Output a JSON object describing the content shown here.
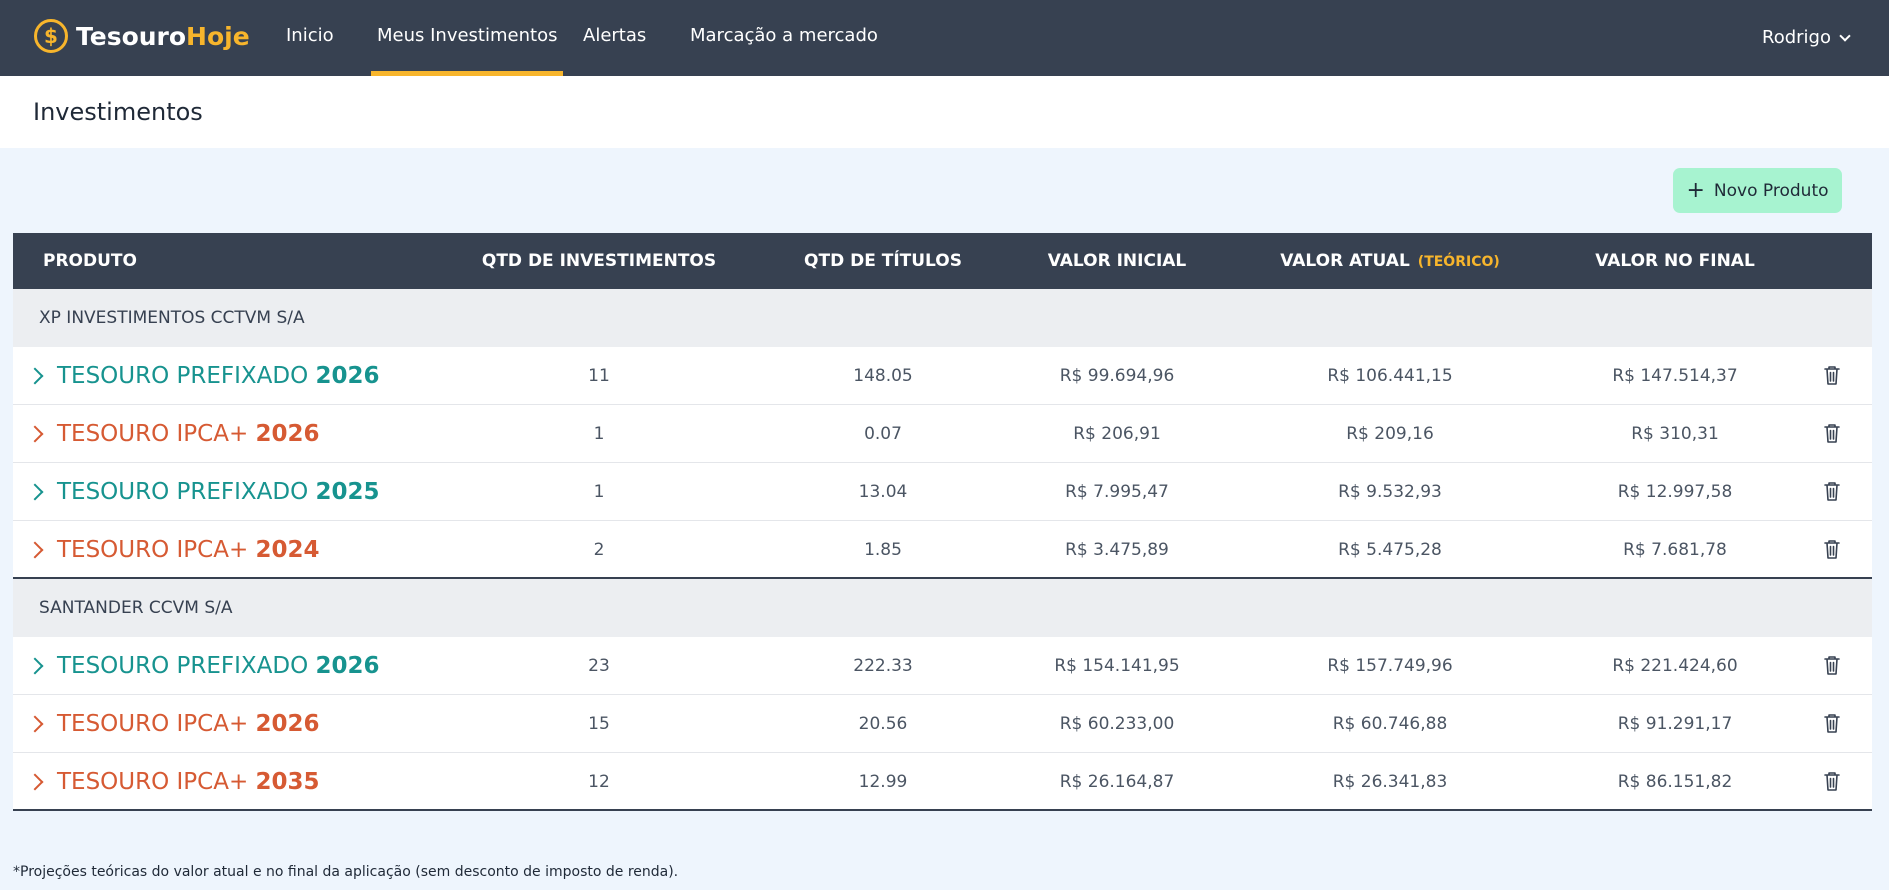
{
  "app": {
    "logo_part1": "Tesouro",
    "logo_part2": "Hoje",
    "brand_color": "#f7b52c",
    "header_color": "#374151"
  },
  "nav": {
    "items": [
      "Inicio",
      "Meus Investimentos",
      "Alertas",
      "Marcação a mercado"
    ],
    "active": "Meus Investimentos"
  },
  "user": {
    "name": "Rodrigo"
  },
  "page": {
    "title": "Investimentos",
    "new_button": "Novo Produto"
  },
  "table": {
    "headers": {
      "produto": "PRODUTO",
      "qtd_investimentos": "QTD DE INVESTIMENTOS",
      "qtd_titulos": "QTD DE TÍTULOS",
      "valor_inicial": "VALOR INICIAL",
      "valor_atual": "VALOR ATUAL",
      "valor_atual_note": "(TEÓRICO)",
      "valor_final": "VALOR NO FINAL"
    },
    "groups": [
      {
        "broker": "XP INVESTIMENTOS CCTVM S/A",
        "rows": [
          {
            "name": "TESOURO PREFIXADO",
            "year": "2026",
            "kind": "prefixado",
            "qtd": "11",
            "titulos": "148.05",
            "inicial": "R$ 99.694,96",
            "atual": "R$ 106.441,15",
            "final": "R$ 147.514,37"
          },
          {
            "name": "TESOURO IPCA+",
            "year": "2026",
            "kind": "ipca",
            "qtd": "1",
            "titulos": "0.07",
            "inicial": "R$ 206,91",
            "atual": "R$ 209,16",
            "final": "R$ 310,31"
          },
          {
            "name": "TESOURO PREFIXADO",
            "year": "2025",
            "kind": "prefixado",
            "qtd": "1",
            "titulos": "13.04",
            "inicial": "R$ 7.995,47",
            "atual": "R$ 9.532,93",
            "final": "R$ 12.997,58"
          },
          {
            "name": "TESOURO IPCA+",
            "year": "2024",
            "kind": "ipca",
            "qtd": "2",
            "titulos": "1.85",
            "inicial": "R$ 3.475,89",
            "atual": "R$ 5.475,28",
            "final": "R$ 7.681,78"
          }
        ]
      },
      {
        "broker": "SANTANDER CCVM S/A",
        "rows": [
          {
            "name": "TESOURO PREFIXADO",
            "year": "2026",
            "kind": "prefixado",
            "qtd": "23",
            "titulos": "222.33",
            "inicial": "R$ 154.141,95",
            "atual": "R$ 157.749,96",
            "final": "R$ 221.424,60"
          },
          {
            "name": "TESOURO IPCA+",
            "year": "2026",
            "kind": "ipca",
            "qtd": "15",
            "titulos": "20.56",
            "inicial": "R$ 60.233,00",
            "atual": "R$ 60.746,88",
            "final": "R$ 91.291,17"
          },
          {
            "name": "TESOURO IPCA+",
            "year": "2035",
            "kind": "ipca",
            "qtd": "12",
            "titulos": "12.99",
            "inicial": "R$ 26.164,87",
            "atual": "R$ 26.341,83",
            "final": "R$ 86.151,82"
          }
        ]
      }
    ]
  },
  "colors": {
    "prefixado": "#17938f",
    "ipca": "#d65a33",
    "new_button": "#a7f3d0"
  },
  "footnote": "*Projeções teóricas do valor atual e no final da aplicação (sem desconto de imposto de renda).",
  "icons": {
    "logo": "dollar-coin-icon",
    "row_expand": "chevron-right-icon",
    "row_delete": "trash-icon",
    "user_menu": "chevron-down-icon",
    "new_button": "plus-icon"
  }
}
